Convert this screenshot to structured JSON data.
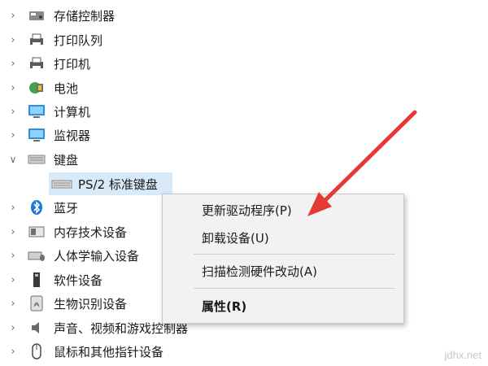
{
  "tree": {
    "items": [
      {
        "label": "存储控制器",
        "icon": "storage-controller-icon"
      },
      {
        "label": "打印队列",
        "icon": "printer-queue-icon"
      },
      {
        "label": "打印机",
        "icon": "printer-icon"
      },
      {
        "label": "电池",
        "icon": "battery-icon"
      },
      {
        "label": "计算机",
        "icon": "computer-icon"
      },
      {
        "label": "监视器",
        "icon": "monitor-icon"
      },
      {
        "label": "键盘",
        "icon": "keyboard-icon",
        "expanded": true
      },
      {
        "label": "PS/2 标准键盘",
        "icon": "keyboard-icon",
        "child": true,
        "selected": true
      },
      {
        "label": "蓝牙",
        "icon": "bluetooth-icon"
      },
      {
        "label": "内存技术设备",
        "icon": "memory-icon"
      },
      {
        "label": "人体学输入设备",
        "icon": "hid-icon"
      },
      {
        "label": "软件设备",
        "icon": "software-device-icon"
      },
      {
        "label": "生物识别设备",
        "icon": "biometric-icon"
      },
      {
        "label": "声音、视频和游戏控制器",
        "icon": "speaker-icon"
      },
      {
        "label": "鼠标和其他指针设备",
        "icon": "mouse-icon"
      }
    ]
  },
  "context_menu": {
    "update_driver": "更新驱动程序(P)",
    "uninstall": "卸载设备(U)",
    "scan": "扫描检测硬件改动(A)",
    "properties": "属性(R)"
  },
  "watermark": "jdhx.net",
  "colors": {
    "selection": "#d8e9f8",
    "arrow": "#e53935",
    "bluetooth": "#1e78d6"
  }
}
